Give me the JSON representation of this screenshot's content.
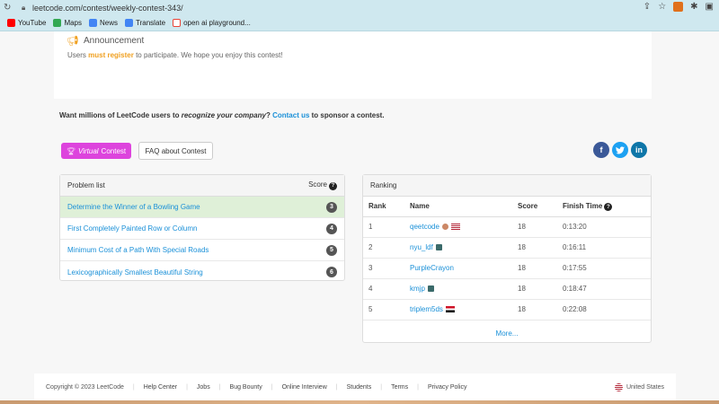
{
  "browser": {
    "url": "leetcode.com/contest/weekly-contest-343/",
    "bookmarks": [
      {
        "label": "YouTube",
        "color": "#ff0000"
      },
      {
        "label": "Maps",
        "color": "#34a853"
      },
      {
        "label": "News",
        "color": "#4285f4"
      },
      {
        "label": "Translate",
        "color": "#4285f4"
      },
      {
        "label": "open ai playground...",
        "color": "#ea4335"
      }
    ]
  },
  "announcement": {
    "title": "Announcement",
    "text_before": "Users ",
    "must": "must",
    "register": "register",
    "text_after": " to participate. We hope you enjoy this contest!"
  },
  "sponsor": {
    "before": "Want millions of LeetCode users to ",
    "italic": "recognize your company",
    "middle": "? ",
    "link": "Contact us",
    "after": " to sponsor a contest."
  },
  "buttons": {
    "virtual_italic": "Virtual",
    "virtual_rest": " Contest",
    "faq": "FAQ about Contest"
  },
  "social": {
    "facebook": "f",
    "twitter": "t",
    "linkedin": "in"
  },
  "problems": {
    "header": "Problem list",
    "score_label": "Score",
    "items": [
      {
        "title": "Determine the Winner of a Bowling Game",
        "score": "3"
      },
      {
        "title": "First Completely Painted Row or Column",
        "score": "4"
      },
      {
        "title": "Minimum Cost of a Path With Special Roads",
        "score": "5"
      },
      {
        "title": "Lexicographically Smallest Beautiful String",
        "score": "6"
      }
    ]
  },
  "ranking": {
    "header": "Ranking",
    "columns": {
      "rank": "Rank",
      "name": "Name",
      "score": "Score",
      "finish": "Finish Time"
    },
    "rows": [
      {
        "rank": "1",
        "name": "qeetcode",
        "score": "18",
        "finish": "0:13:20"
      },
      {
        "rank": "2",
        "name": "nyu_ldf",
        "score": "18",
        "finish": "0:16:11"
      },
      {
        "rank": "3",
        "name": "PurpleCrayon",
        "score": "18",
        "finish": "0:17:55"
      },
      {
        "rank": "4",
        "name": "kmjp",
        "score": "18",
        "finish": "0:18:47"
      },
      {
        "rank": "5",
        "name": "triplem5ds",
        "score": "18",
        "finish": "0:22:08"
      }
    ],
    "more": "More..."
  },
  "footer": {
    "copyright": "Copyright © 2023 LeetCode",
    "links": [
      "Help Center",
      "Jobs",
      "Bug Bounty",
      "Online Interview",
      "Students",
      "Terms",
      "Privacy Policy"
    ],
    "country": "United States"
  }
}
